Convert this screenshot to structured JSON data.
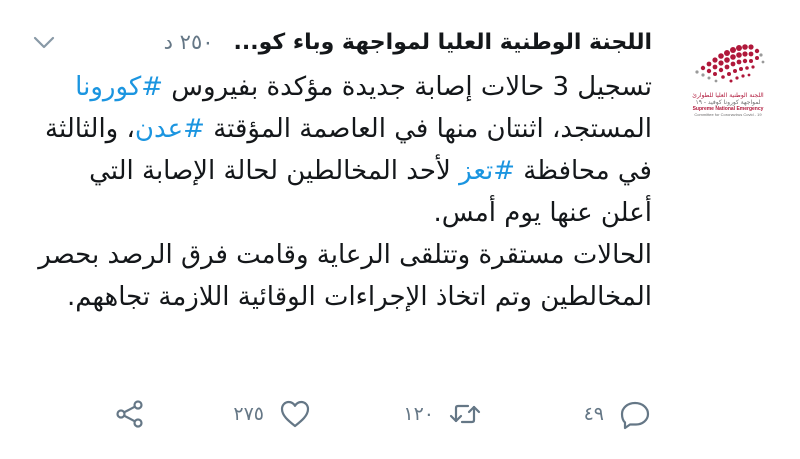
{
  "author": {
    "display_name": "اللجنة الوطنية العليا لمواجهة وباء كو...",
    "handle_time": "٢٥٠ د",
    "avatar_text": {
      "line1": "اللجنة الوطنية العليا للطوارئ",
      "line2": "لمواجهة كورونا كوفيد - ١٩",
      "line3": "Supreme National Emergency",
      "line4": "Committee for Coronavirus Covid - 19"
    }
  },
  "tweet": {
    "segments": [
      {
        "text": "تسجيل 3 حالات إصابة جديدة مؤكدة بفيروس ",
        "hashtag": false
      },
      {
        "text": "#كورونا",
        "hashtag": true
      },
      {
        "text": " المستجد، اثنتان منها في العاصمة المؤقتة ",
        "hashtag": false
      },
      {
        "text": "#عدن",
        "hashtag": true
      },
      {
        "text": "، والثالثة في محافظة ",
        "hashtag": false
      },
      {
        "text": "#تعز",
        "hashtag": true
      },
      {
        "text": " لأحد المخالطين لحالة الإصابة التي أعلن عنها يوم أمس.",
        "hashtag": false
      }
    ],
    "paragraph2": "الحالات مستقرة وتتلقى الرعاية وقامت فرق الرصد بحصر المخالطين وتم اتخاذ الإجراءات الوقائية اللازمة تجاههم."
  },
  "actions": {
    "reply_count": "٤٩",
    "retweet_count": "١٢٠",
    "like_count": "٢٧٥",
    "icons": {
      "reply": "reply-icon",
      "retweet": "retweet-icon",
      "like": "heart-icon",
      "share": "share-icon",
      "more": "chevron-down-icon"
    }
  },
  "colors": {
    "hashtag": "#1b95e0",
    "text": "#14171a",
    "muted": "#657786",
    "brand": "#b0183b"
  }
}
